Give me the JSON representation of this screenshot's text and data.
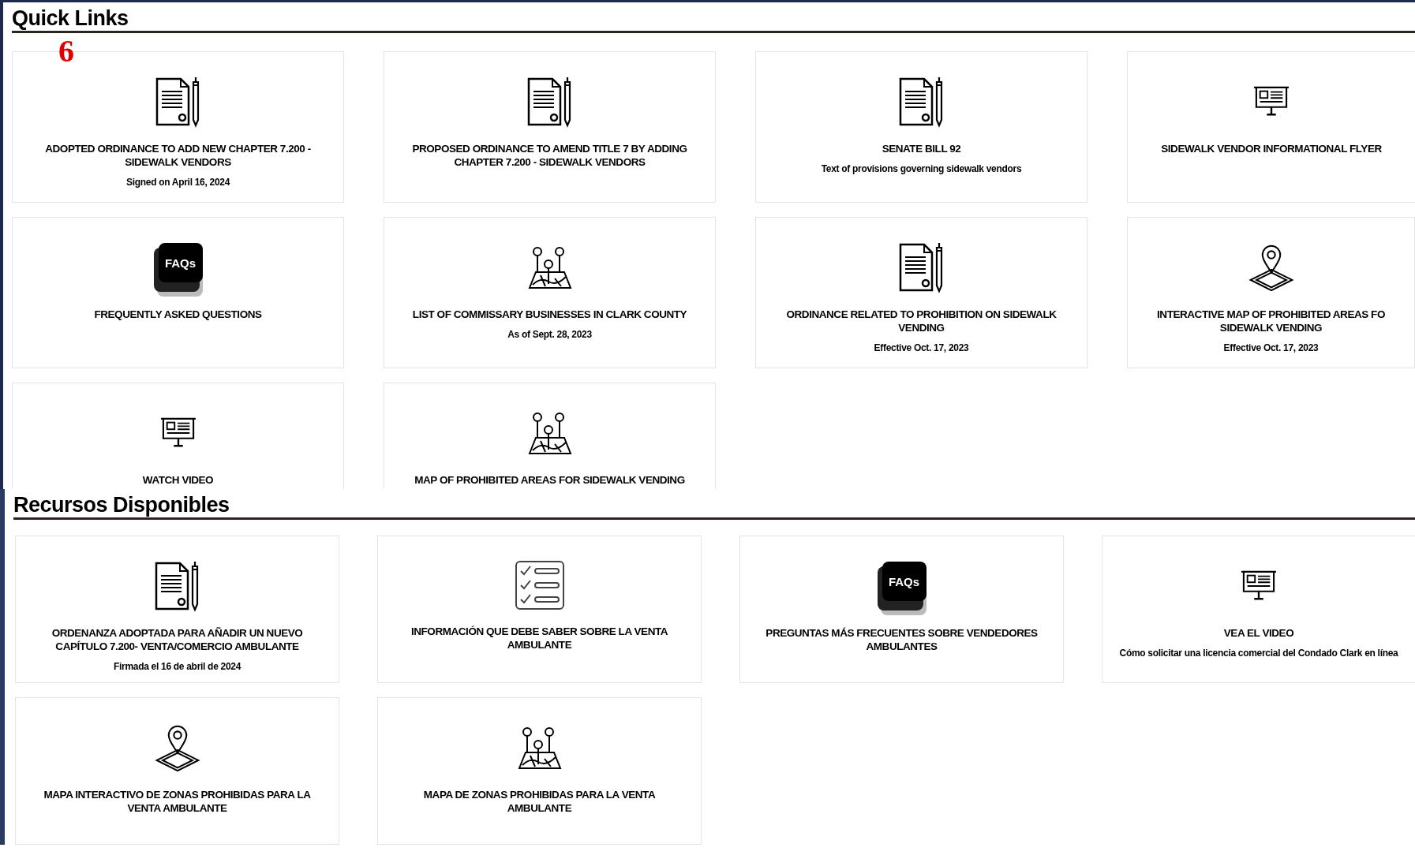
{
  "annotation": "6",
  "sections": [
    {
      "title": "Quick Links",
      "cards": [
        {
          "kind": "document",
          "title": "ADOPTED ORDINANCE TO ADD NEW CHAPTER 7.200 - SIDEWALK VENDORS",
          "subtitle": "Signed on April 16, 2024"
        },
        {
          "kind": "document",
          "title": "PROPOSED ORDINANCE TO AMEND TITLE 7 BY ADDING CHAPTER 7.200 - SIDEWALK VENDORS"
        },
        {
          "kind": "document",
          "title": "SENATE BILL 92",
          "subtitle": "Text of provisions governing sidewalk vendors"
        },
        {
          "kind": "screen",
          "title": "SIDEWALK VENDOR INFORMATIONAL FLYER"
        },
        {
          "kind": "faq",
          "icon_text": "FAQs",
          "title": "FREQUENTLY ASKED QUESTIONS"
        },
        {
          "kind": "pins",
          "title": "LIST OF COMMISSARY BUSINESSES IN CLARK COUNTY",
          "subtitle": "As of Sept. 28, 2023"
        },
        {
          "kind": "document",
          "title": "ORDINANCE RELATED TO PROHIBITION ON SIDEWALK VENDING",
          "subtitle": "Effective Oct. 17, 2023"
        },
        {
          "kind": "location",
          "title": "INTERACTIVE MAP OF PROHIBITED AREAS FO SIDEWALK VENDING",
          "subtitle": "Effective Oct. 17, 2023"
        },
        {
          "kind": "screen",
          "title": "WATCH VIDEO"
        },
        {
          "kind": "pins",
          "title": "MAP OF PROHIBITED AREAS FOR SIDEWALK VENDING"
        }
      ]
    },
    {
      "title": "Recursos Disponibles",
      "cards": [
        {
          "kind": "document",
          "title": "ORDENANZA ADOPTADA PARA AÑADIR UN NUEVO CAPÍTULO 7.200- VENTA/COMERCIO AMBULANTE",
          "subtitle": "Firmada el 16 de abril de 2024"
        },
        {
          "kind": "checklist",
          "title": "INFORMACIÓN QUE DEBE SABER SOBRE LA VENTA AMBULANTE"
        },
        {
          "kind": "faq",
          "icon_text": "FAQs",
          "title": "PREGUNTAS MÁS FRECUENTES SOBRE VENDEDORES AMBULANTES"
        },
        {
          "kind": "screen",
          "title": "VEA EL VIDEO",
          "subtitle": "Cómo solicitar una licencia comercial del Condado Clark en línea"
        },
        {
          "kind": "location",
          "title": "MAPA INTERACTIVO DE ZONAS PROHIBIDAS PARA LA VENTA AMBULANTE"
        },
        {
          "kind": "pins",
          "title": "MAPA DE ZONAS PROHIBIDAS PARA LA VENTA AMBULANTE"
        }
      ]
    }
  ]
}
